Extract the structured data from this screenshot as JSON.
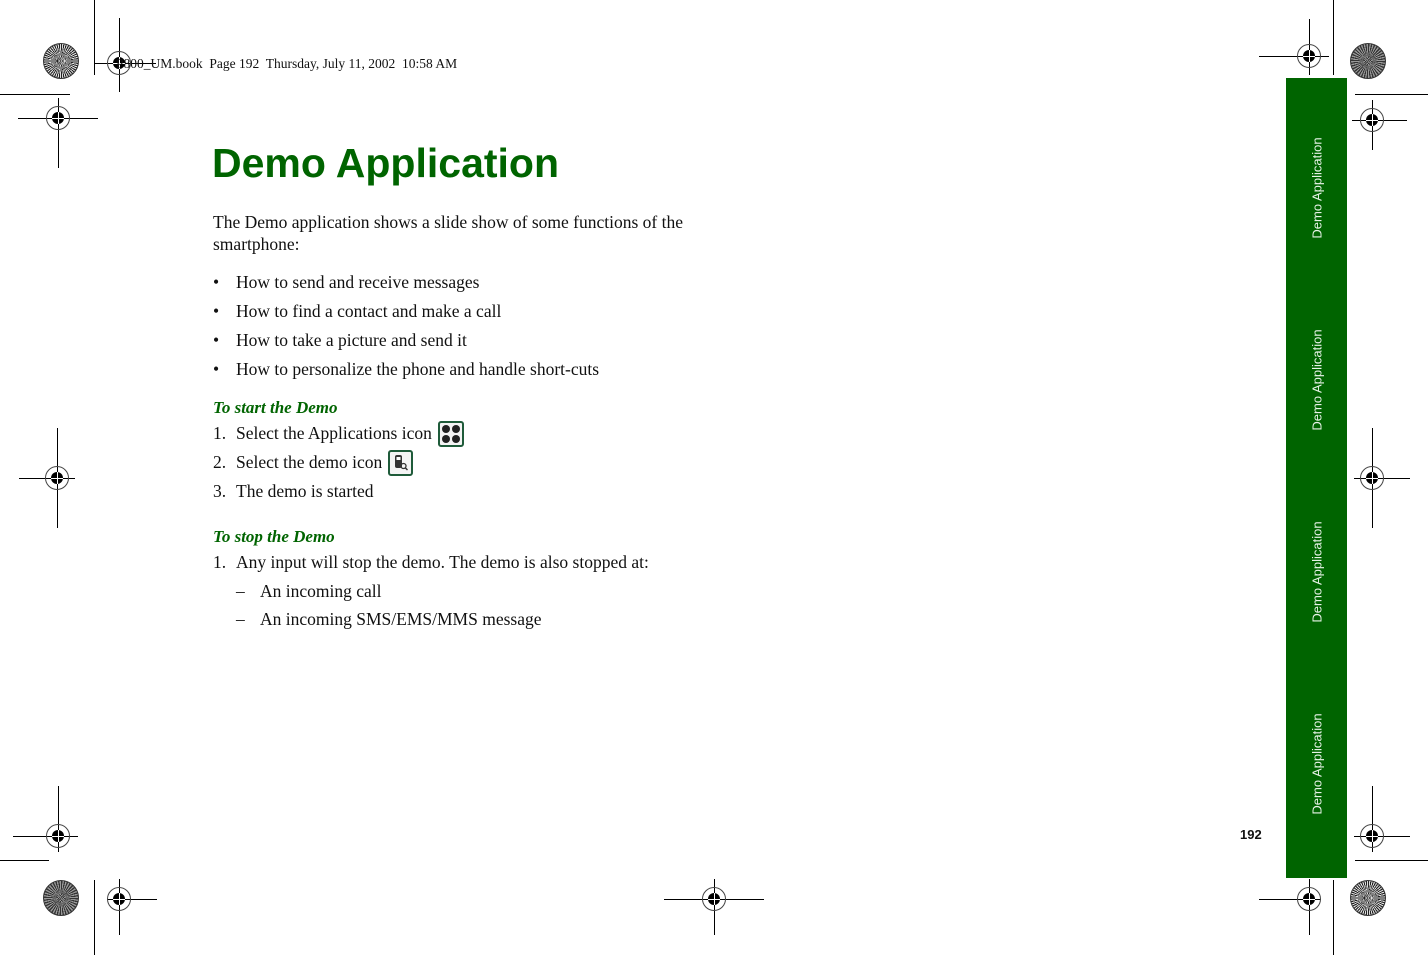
{
  "header": {
    "book_info": "P800_UM.book  Page 192  Thursday, July 11, 2002  10:58 AM"
  },
  "page": {
    "title": "Demo Application",
    "intro": "The Demo application shows a slide show of some functions of the smartphone:",
    "features": [
      "How to send and receive messages",
      "How to find a contact and make a call",
      "How to take a picture and send it",
      "How to personalize the phone and handle short-cuts"
    ],
    "start_section": {
      "heading": "To start the Demo",
      "steps": [
        {
          "num": "1.",
          "text": "Select the Applications icon",
          "icon": "applications-icon"
        },
        {
          "num": "2.",
          "text": "Select the demo icon",
          "icon": "demo-icon"
        },
        {
          "num": "3.",
          "text": "The demo is started"
        }
      ]
    },
    "stop_section": {
      "heading": "To stop the Demo",
      "steps": [
        {
          "num": "1.",
          "text": "Any input will stop the demo. The demo is also stopped at:"
        }
      ],
      "sub_items": [
        "An incoming call",
        "An incoming SMS/EMS/MMS message"
      ]
    }
  },
  "side_tab": {
    "labels": [
      "Demo Application",
      "Demo Application",
      "Demo Application",
      "Demo Application"
    ],
    "color": "#006400"
  },
  "page_number": "192",
  "bullet_char": "•",
  "dash_char": "–"
}
